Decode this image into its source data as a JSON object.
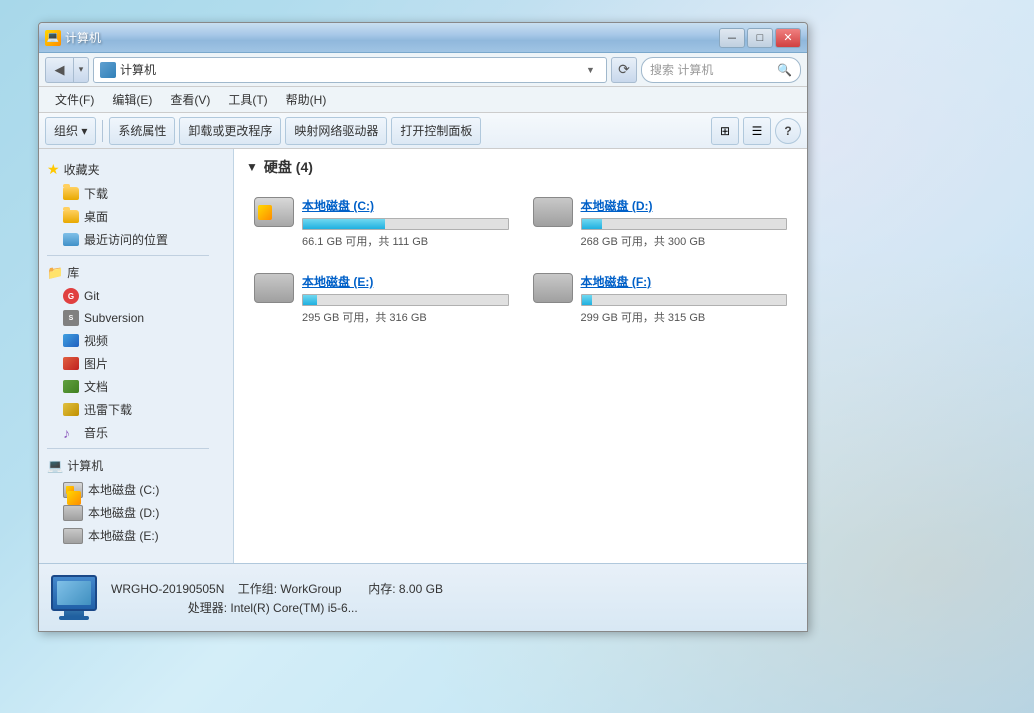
{
  "window": {
    "title": "计算机",
    "minimize": "－",
    "maximize": "□",
    "close": "✕"
  },
  "address_bar": {
    "path": "计算机",
    "path_icon": "computer",
    "search_placeholder": "搜索 计算机",
    "refresh_symbol": "⟳",
    "dropdown_arrow": "▼",
    "nav_back": "◀",
    "nav_forward": "▶",
    "nav_up": "▲"
  },
  "menu": {
    "items": [
      "文件(F)",
      "编辑(E)",
      "查看(V)",
      "工具(T)",
      "帮助(H)"
    ]
  },
  "toolbar": {
    "organize_label": "组织 ▾",
    "system_props_label": "系统属性",
    "uninstall_label": "卸载或更改程序",
    "map_drive_label": "映射网络驱动器",
    "control_panel_label": "打开控制面板",
    "view_options": "⊞",
    "help": "?"
  },
  "sidebar": {
    "favorites": {
      "header": "收藏夹",
      "items": [
        {
          "label": "下载",
          "icon": "download-folder"
        },
        {
          "label": "桌面",
          "icon": "desktop-folder"
        },
        {
          "label": "最近访问的位置",
          "icon": "recent-folder"
        }
      ]
    },
    "library": {
      "header": "库",
      "items": [
        {
          "label": "Git",
          "icon": "git-icon"
        },
        {
          "label": "Subversion",
          "icon": "svn-icon"
        },
        {
          "label": "视频",
          "icon": "video-icon"
        },
        {
          "label": "图片",
          "icon": "image-icon"
        },
        {
          "label": "文档",
          "icon": "doc-icon"
        },
        {
          "label": "迅雷下载",
          "icon": "download-special-icon"
        },
        {
          "label": "音乐",
          "icon": "music-icon"
        }
      ]
    },
    "computer": {
      "header": "计算机",
      "items": [
        {
          "label": "本地磁盘 (C:)",
          "icon": "hdd-c"
        },
        {
          "label": "本地磁盘 (D:)",
          "icon": "hdd-d"
        },
        {
          "label": "本地磁盘 (E:)",
          "icon": "hdd-e"
        }
      ]
    }
  },
  "main": {
    "section_title": "硬盘 (4)",
    "drives": [
      {
        "name": "本地磁盘 (C:)",
        "free": "66.1 GB 可用",
        "total": "共 111 GB",
        "fill_percent": 40,
        "type": "system"
      },
      {
        "name": "本地磁盘 (D:)",
        "free": "268 GB 可用",
        "total": "共 300 GB",
        "fill_percent": 10,
        "type": "plain"
      },
      {
        "name": "本地磁盘 (E:)",
        "free": "295 GB 可用",
        "total": "共 316 GB",
        "fill_percent": 7,
        "type": "plain"
      },
      {
        "name": "本地磁盘 (F:)",
        "free": "299 GB 可用",
        "total": "共 315 GB",
        "fill_percent": 5,
        "type": "plain"
      }
    ]
  },
  "status_bar": {
    "computer_name": "WRGHO-20190505N",
    "workgroup_label": "工作组:",
    "workgroup_value": "WorkGroup",
    "memory_label": "内存:",
    "memory_value": "8.00 GB",
    "cpu_label": "处理器:",
    "cpu_value": "Intel(R) Core(TM) i5-6..."
  }
}
